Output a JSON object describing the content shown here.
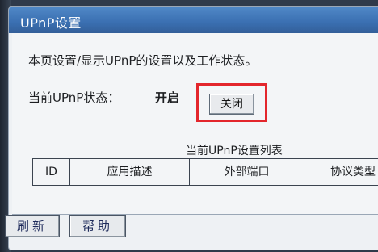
{
  "window": {
    "title": "UPnP设置"
  },
  "content": {
    "description": "本页设置/显示UPnP的设置以及工作状态。",
    "status_label": "当前UPnP状态：",
    "status_value": "开启",
    "close_button_label": "关闭"
  },
  "list": {
    "title": "当前UPnP设置列表",
    "columns": [
      "ID",
      "应用描述",
      "外部端口",
      "协议类型"
    ]
  },
  "footer": {
    "refresh_label": "刷新",
    "help_label": "帮助"
  },
  "colors": {
    "titlebar": "#3a6fb1",
    "highlight": "#e3262c"
  }
}
